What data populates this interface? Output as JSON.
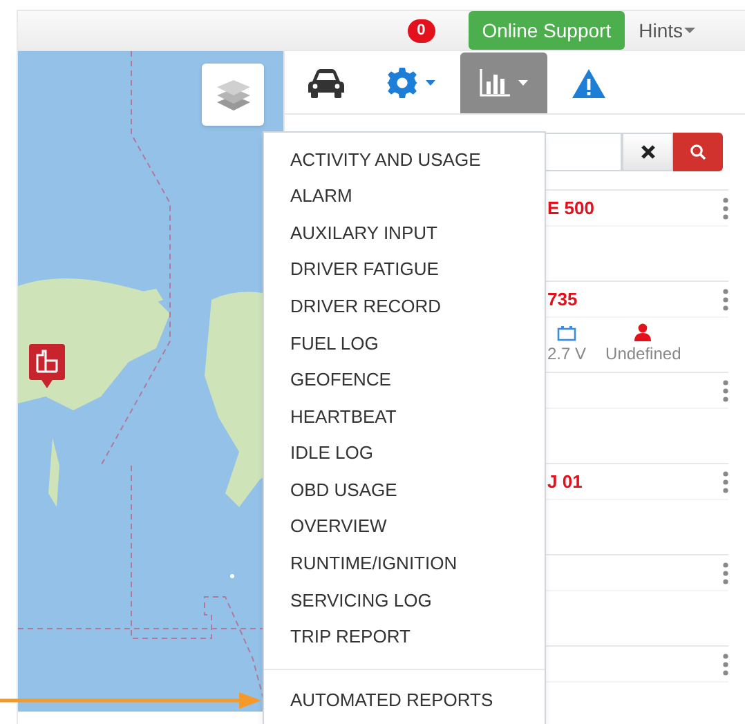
{
  "header": {
    "notification_count": "0",
    "support_button": "Online Support",
    "hints_menu": "Hints"
  },
  "toolbar": {
    "tabs": [
      {
        "kind": "car",
        "selected": false,
        "has_menu": false
      },
      {
        "kind": "gear",
        "selected": false,
        "has_menu": true
      },
      {
        "kind": "chart",
        "selected": true,
        "has_menu": true
      },
      {
        "kind": "warning",
        "selected": false,
        "has_menu": false
      }
    ]
  },
  "vehicles": [
    {
      "kind": "vehicle",
      "name": "E 500"
    },
    {
      "kind": "vehicle",
      "name": "735",
      "voltage": "2.7 V",
      "driver": "Undefined"
    },
    {
      "kind": "vehicle"
    },
    {
      "kind": "vehicle",
      "name": "J 01"
    },
    {
      "kind": "vehicle"
    },
    {
      "kind": "vehicle"
    }
  ],
  "reports_menu": {
    "items": [
      "ACTIVITY AND USAGE",
      "ALARM",
      "AUXILARY INPUT",
      "DRIVER FATIGUE",
      "DRIVER RECORD",
      "FUEL LOG",
      "GEOFENCE",
      "HEARTBEAT",
      "IDLE LOG",
      "OBD USAGE",
      "OVERVIEW",
      "RUNTIME/IGNITION",
      "SERVICING LOG",
      "TRIP REPORT"
    ],
    "footer_items": [
      "AUTOMATED REPORTS"
    ]
  }
}
